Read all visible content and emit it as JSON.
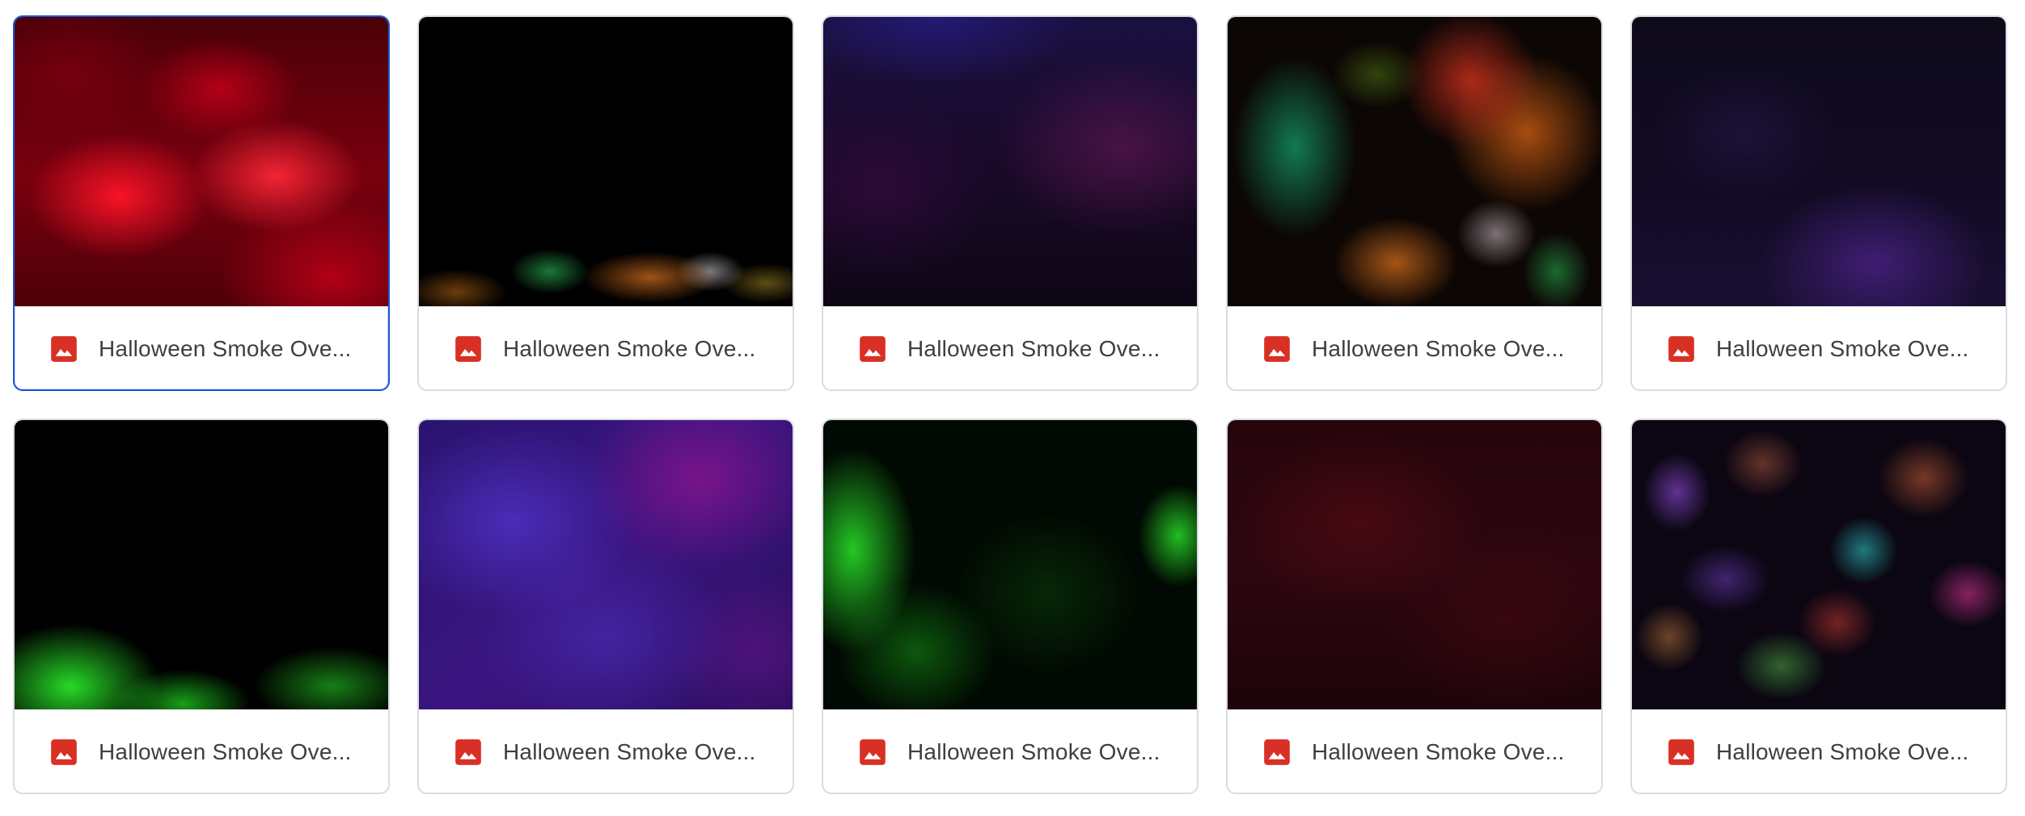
{
  "files": [
    {
      "name": "Halloween Smoke Ove...",
      "type": "image",
      "selected": true
    },
    {
      "name": "Halloween Smoke Ove...",
      "type": "image",
      "selected": false
    },
    {
      "name": "Halloween Smoke Ove...",
      "type": "image",
      "selected": false
    },
    {
      "name": "Halloween Smoke Ove...",
      "type": "image",
      "selected": false
    },
    {
      "name": "Halloween Smoke Ove...",
      "type": "image",
      "selected": false
    },
    {
      "name": "Halloween Smoke Ove...",
      "type": "image",
      "selected": false
    },
    {
      "name": "Halloween Smoke Ove...",
      "type": "image",
      "selected": false
    },
    {
      "name": "Halloween Smoke Ove...",
      "type": "image",
      "selected": false
    },
    {
      "name": "Halloween Smoke Ove...",
      "type": "image",
      "selected": false
    },
    {
      "name": "Halloween Smoke Ove...",
      "type": "image",
      "selected": false
    }
  ],
  "icons": {
    "file_type": "image-file-icon"
  },
  "colors": {
    "image_icon": "#d93025",
    "selected_border": "#1a56d6",
    "card_border": "#dadce0",
    "text": "#3c4043"
  }
}
